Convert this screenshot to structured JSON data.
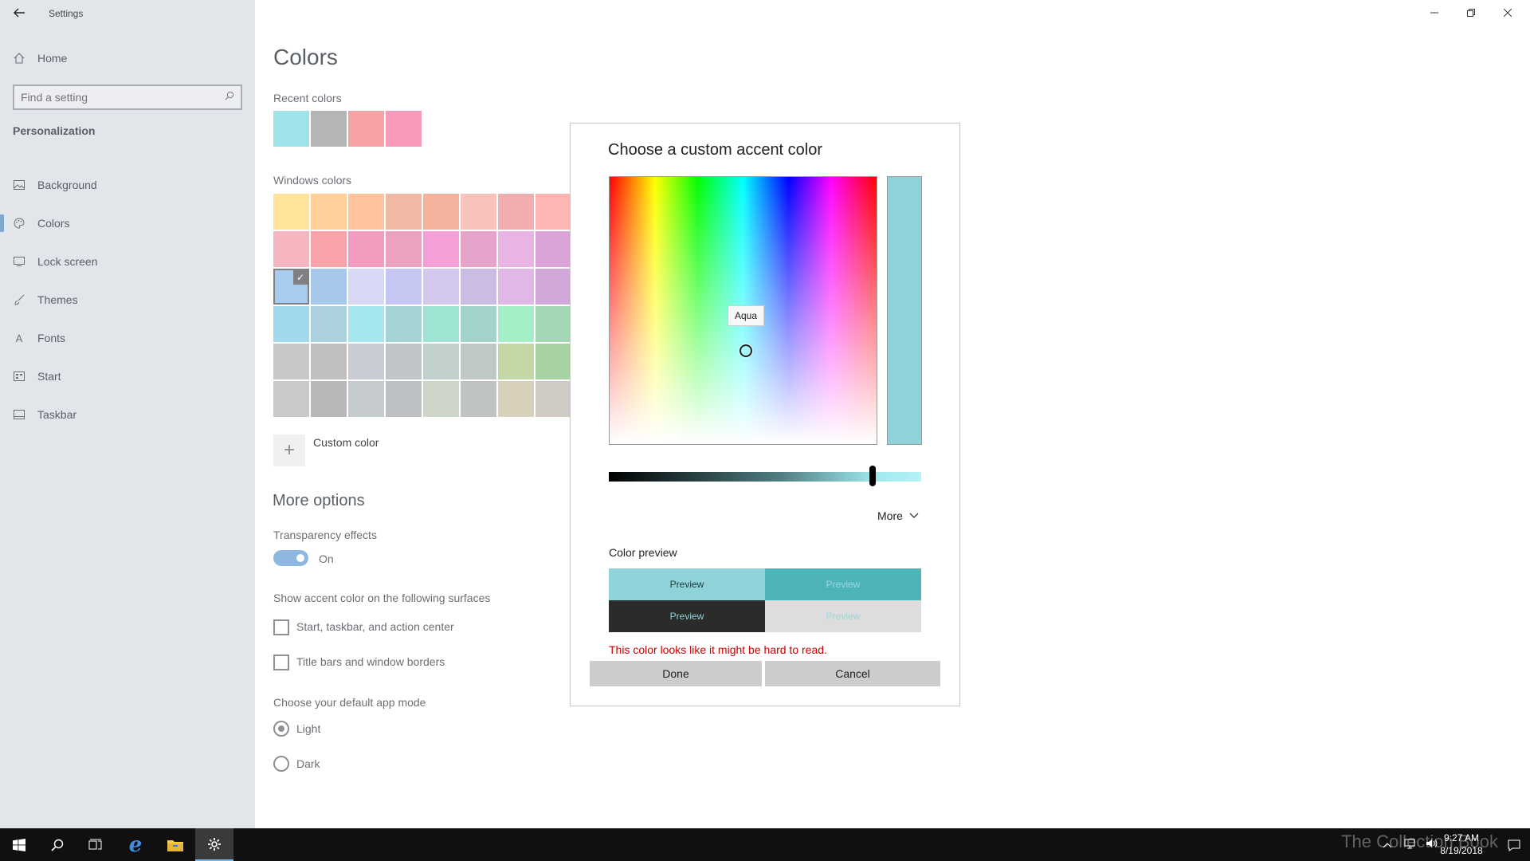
{
  "window": {
    "title": "Settings",
    "controls": [
      "minimize",
      "restore",
      "close"
    ]
  },
  "sidebar": {
    "home_label": "Home",
    "search_placeholder": "Find a setting",
    "section_title": "Personalization",
    "items": [
      {
        "label": "Background",
        "icon": "image-icon",
        "active": false
      },
      {
        "label": "Colors",
        "icon": "palette-icon",
        "active": true
      },
      {
        "label": "Lock screen",
        "icon": "lock-screen-icon",
        "active": false
      },
      {
        "label": "Themes",
        "icon": "brush-icon",
        "active": false
      },
      {
        "label": "Fonts",
        "icon": "font-icon",
        "active": false
      },
      {
        "label": "Start",
        "icon": "start-icon",
        "active": false
      },
      {
        "label": "Taskbar",
        "icon": "taskbar-icon",
        "active": false
      }
    ]
  },
  "main": {
    "title": "Colors",
    "recent_label": "Recent colors",
    "recent_colors": [
      "#9de3e8",
      "#b5b5b5",
      "#f7a3a5",
      "#f79ab9"
    ],
    "windows_label": "Windows colors",
    "windows_colors": [
      "#ffe399",
      "#ffcf99",
      "#ffc49e",
      "#efb9a3",
      "#f4b19b",
      "#f8c3bd",
      "#f1aeb0",
      "#feb6b4",
      "#f5b6c0",
      "#f7a3a9",
      "#f49cc0",
      "#eca2bf",
      "#f4a0d6",
      "#e6a4cb",
      "#e9b3e3",
      "#dca3d6",
      "#a8cbf0",
      "#a8c8eb",
      "#d7d8f3",
      "#c5c6f2",
      "#d3c8ec",
      "#cbbde2",
      "#e0b8e8",
      "#d2a8db",
      "#a1d8eb",
      "#acd0dd",
      "#a5e5ed",
      "#a4d3d6",
      "#9ee4d3",
      "#a2d4cb",
      "#a6eec6",
      "#a3d7b6",
      "#c8c8c8",
      "#c0bfbd",
      "#c9ccd4",
      "#c0c3c8",
      "#c3d1cc",
      "#c0c8c4",
      "#c4d7a6",
      "#a7d3a3",
      "#c9c9c9",
      "#b8b8b8",
      "#c6cbce",
      "#bdc0c2",
      "#cdd4c8",
      "#bfc4c1",
      "#d8d0bb",
      "#d0cbc5"
    ],
    "selected_index": 16,
    "custom_color_label": "Custom color",
    "more_options_title": "More options",
    "transparency_label": "Transparency effects",
    "transparency_state": "On",
    "accent_surfaces_label": "Show accent color on the following surfaces",
    "checkbox_start": "Start, taskbar, and action center",
    "checkbox_titlebars": "Title bars and window borders",
    "app_mode_label": "Choose your default app mode",
    "mode_light": "Light",
    "mode_dark": "Dark",
    "selected_mode": "Light"
  },
  "dialog": {
    "title": "Choose a custom accent color",
    "tooltip": "Aqua",
    "more_label": "More",
    "color_preview_label": "Color preview",
    "preview_text": "Preview",
    "selected_color": "#8fd2d7",
    "warning": "This color looks like it might be hard to read.",
    "done_label": "Done",
    "cancel_label": "Cancel",
    "preview_cells": [
      {
        "bg": "#8fd2d7",
        "fg": "#1a3a3c"
      },
      {
        "bg": "#4fb4ba",
        "fg": "#9ad9dd"
      },
      {
        "bg": "#2b2b2b",
        "fg": "#8fd2d7"
      },
      {
        "bg": "#dddddd",
        "fg": "#9fd6da"
      }
    ]
  },
  "taskbar": {
    "apps": [
      "start-icon",
      "search-icon",
      "task-view-icon",
      "edge-icon",
      "file-explorer-icon",
      "settings-icon"
    ],
    "active_app": "settings-icon",
    "time": "9:27 AM",
    "date": "8/19/2018",
    "watermark": "The Collection Book"
  }
}
